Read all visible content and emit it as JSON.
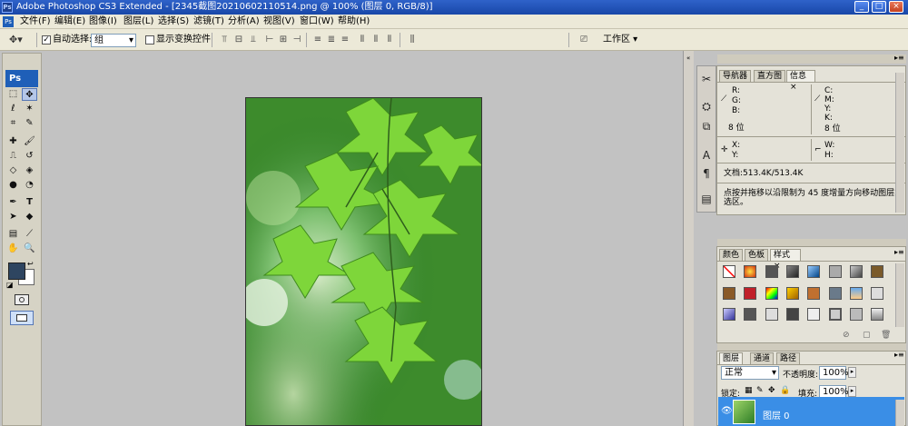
{
  "window": {
    "title": "Adobe Photoshop CS3 Extended - [2345截图20210602110514.png @ 100% (图层 0, RGB/8)]",
    "app_icon_text": "Ps",
    "minimize": "_",
    "restore": "□",
    "close": "×"
  },
  "menu": [
    "文件(F)",
    "编辑(E)",
    "图像(I)",
    "图层(L)",
    "选择(S)",
    "滤镜(T)",
    "分析(A)",
    "视图(V)",
    "窗口(W)",
    "帮助(H)"
  ],
  "options": {
    "auto_select_label": "自动选择:",
    "auto_select_value": "组",
    "show_transform_label": "显示变换控件",
    "workspace_label": "工作区 ▾"
  },
  "toolbox": {
    "logo": "Ps"
  },
  "navigator_panel": {
    "tabs": [
      "导航器",
      "直方图",
      "信息"
    ],
    "close_glyph": "×",
    "rgb": [
      "R:",
      "G:",
      "B:"
    ],
    "cmyk": [
      "C:",
      "M:",
      "Y:",
      "K:"
    ],
    "bits_left": "8 位",
    "bits_right": "8 位",
    "xy": [
      "X:",
      "Y:"
    ],
    "wh": [
      "W:",
      "H:"
    ],
    "doc_info": "文档:513.4K/513.4K",
    "hint": "点按并拖移以沿限制为 45 度增量方向移动图层或选区。"
  },
  "styles_panel": {
    "tabs": [
      "颜色",
      "色板",
      "样式"
    ],
    "close_glyph": "×"
  },
  "layers_panel": {
    "tabs": [
      "图层",
      "通道",
      "路径"
    ],
    "blend_mode": "正常",
    "opacity_label": "不透明度:",
    "opacity_value": "100%",
    "lock_label": "锁定:",
    "fill_label": "填充:",
    "fill_value": "100%",
    "layer_name": "图层 0"
  }
}
